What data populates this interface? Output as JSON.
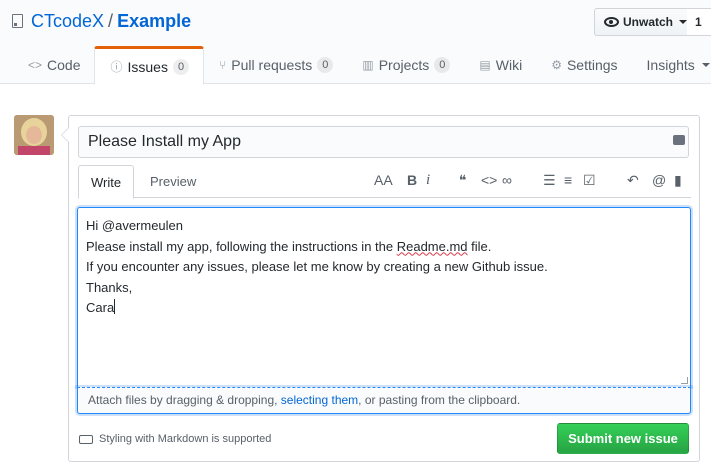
{
  "repo": {
    "owner": "CTcodeX",
    "separator": "/",
    "name": "Example"
  },
  "watch": {
    "label": "Unwatch",
    "count": "1"
  },
  "tabs": [
    {
      "icon": "code-icon",
      "glyph": "<>",
      "label": "Code",
      "counter": ""
    },
    {
      "icon": "issue-icon",
      "glyph": "ⓘ",
      "label": "Issues",
      "counter": "0"
    },
    {
      "icon": "pull-request-icon",
      "glyph": "⑂",
      "label": "Pull requests",
      "counter": "0"
    },
    {
      "icon": "project-icon",
      "glyph": "▥",
      "label": "Projects",
      "counter": "0"
    },
    {
      "icon": "wiki-icon",
      "glyph": "▤",
      "label": "Wiki",
      "counter": ""
    },
    {
      "icon": "gear-icon",
      "glyph": "⚙",
      "label": "Settings",
      "counter": ""
    },
    {
      "icon": "",
      "glyph": "",
      "label": "Insights",
      "counter": ""
    }
  ],
  "issue": {
    "title": "Please Install my App",
    "write_tab": "Write",
    "preview_tab": "Preview",
    "body": {
      "line1": "Hi @avermeulen",
      "line2_pre": "Please install my app, following the instructions in the ",
      "line2_mis": "Readme.md",
      "line2_post": " file.",
      "line3": "If you encounter any issues, please let me know by creating a new Github issue.",
      "line4": "Thanks,",
      "line5": "Cara"
    },
    "attach_pre": "Attach files by dragging & dropping, ",
    "attach_link": "selecting them",
    "attach_post": ", or pasting from the clipboard.",
    "markdown_note": "Styling with Markdown is supported",
    "submit_label": "Submit new issue"
  },
  "toolbar": {
    "header": "AA",
    "bold": "B",
    "italic": "i",
    "quote": "❝",
    "code": "<>",
    "link": "∞",
    "bullet": "☰",
    "numbered": "≡",
    "task": "☑",
    "reply": "↶",
    "mention": "@",
    "bookmark": "▮"
  },
  "colors": {
    "accent_orange": "#e36209",
    "link_blue": "#0366d6",
    "submit_green": "#28a745"
  }
}
